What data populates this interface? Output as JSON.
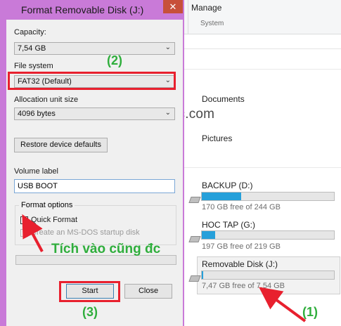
{
  "dialog": {
    "title": "Format Removable Disk (J:)",
    "close_glyph": "✕",
    "capacity_label": "Capacity:",
    "capacity_value": "7,54 GB",
    "filesystem_label": "File system",
    "filesystem_value": "FAT32 (Default)",
    "allocation_label": "Allocation unit size",
    "allocation_value": "4096 bytes",
    "restore_button": "Restore device defaults",
    "volume_label": "Volume label",
    "volume_value": "USB BOOT",
    "format_options_label": "Format options",
    "quick_format_label": "Quick Format",
    "quick_format_checked": false,
    "msdos_label": "Create an MS-DOS startup disk",
    "start_button": "Start",
    "close_button": "Close",
    "combo_chevron": "⌄"
  },
  "explorer": {
    "ribbon_manage": "Manage",
    "ribbon_system": "System",
    "folders": [
      "Documents",
      "Pictures"
    ],
    "drives": [
      {
        "name": "BACKUP (D:)",
        "free": "170 GB free of 244 GB",
        "used_fraction": 0.3
      },
      {
        "name": "HOC TAP (G:)",
        "free": "197 GB free of 219 GB",
        "used_fraction": 0.1
      },
      {
        "name": "Removable Disk (J:)",
        "free": "7,47 GB free of 7,54 GB",
        "used_fraction": 0.01
      }
    ]
  },
  "watermark": "blogchiasekienthuc.com",
  "annotations": {
    "step1": "(1)",
    "step2": "(2)",
    "step3": "(3)",
    "note": "Tích vào cũng đc"
  },
  "colors": {
    "dialog_border": "#c97ad8",
    "close_red": "#c7503a",
    "annotation_red": "#e8202e",
    "annotation_green": "#2fae3c",
    "drive_bar": "#26a0da"
  }
}
